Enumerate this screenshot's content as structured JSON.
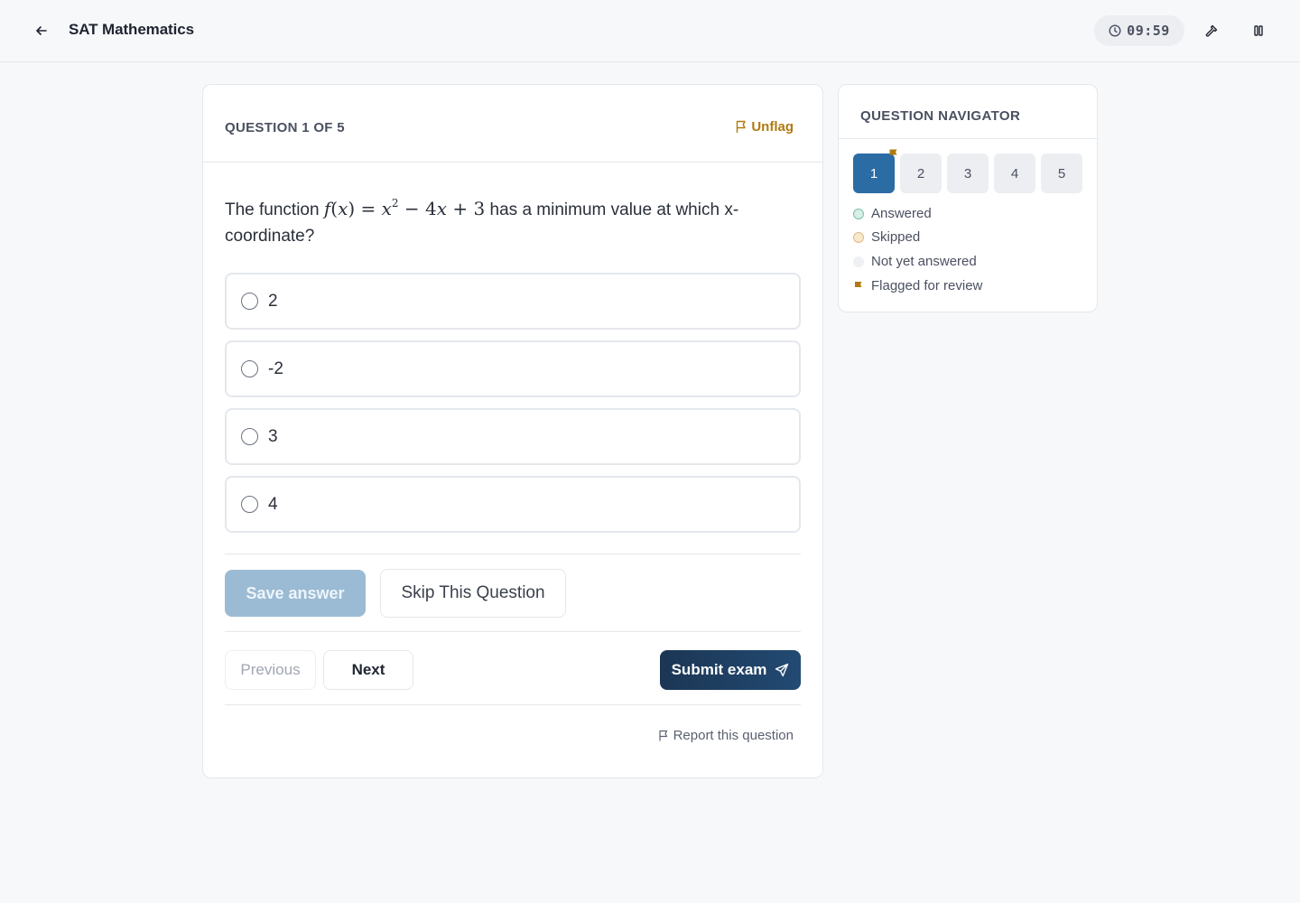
{
  "header": {
    "title": "SAT Mathematics",
    "timer": "09:59"
  },
  "question": {
    "counter": "QUESTION 1 OF 5",
    "flag_label": "Unflag",
    "text_before": "The function ",
    "math": {
      "f": "f",
      "x": "x",
      "exp": "2",
      "coef": "4",
      "const": "3"
    },
    "text_after": " has a minimum value at which x-coordinate?",
    "options": [
      "2",
      "-2",
      "3",
      "4"
    ]
  },
  "actions": {
    "save_label": "Save answer",
    "skip_label": "Skip This Question",
    "previous_label": "Previous",
    "next_label": "Next",
    "submit_label": "Submit exam",
    "report_label": "Report this question"
  },
  "navigator": {
    "title": "QUESTION NAVIGATOR",
    "questions": [
      "1",
      "2",
      "3",
      "4",
      "5"
    ],
    "current": "1",
    "flagged": [
      "1"
    ],
    "legend": {
      "answered": "Answered",
      "skipped": "Skipped",
      "not_yet": "Not yet answered",
      "flagged": "Flagged for review"
    }
  },
  "colors": {
    "accent": "#2b6ca4",
    "flag": "#b07a10",
    "submit": "#1c3654",
    "save_disabled": "#9bbbd4"
  },
  "icons": {
    "back": "arrow-left-icon",
    "timer": "clock-icon",
    "tool": "hammer-icon",
    "pause": "pause-icon",
    "flag": "flag-icon",
    "submit": "send-icon"
  }
}
